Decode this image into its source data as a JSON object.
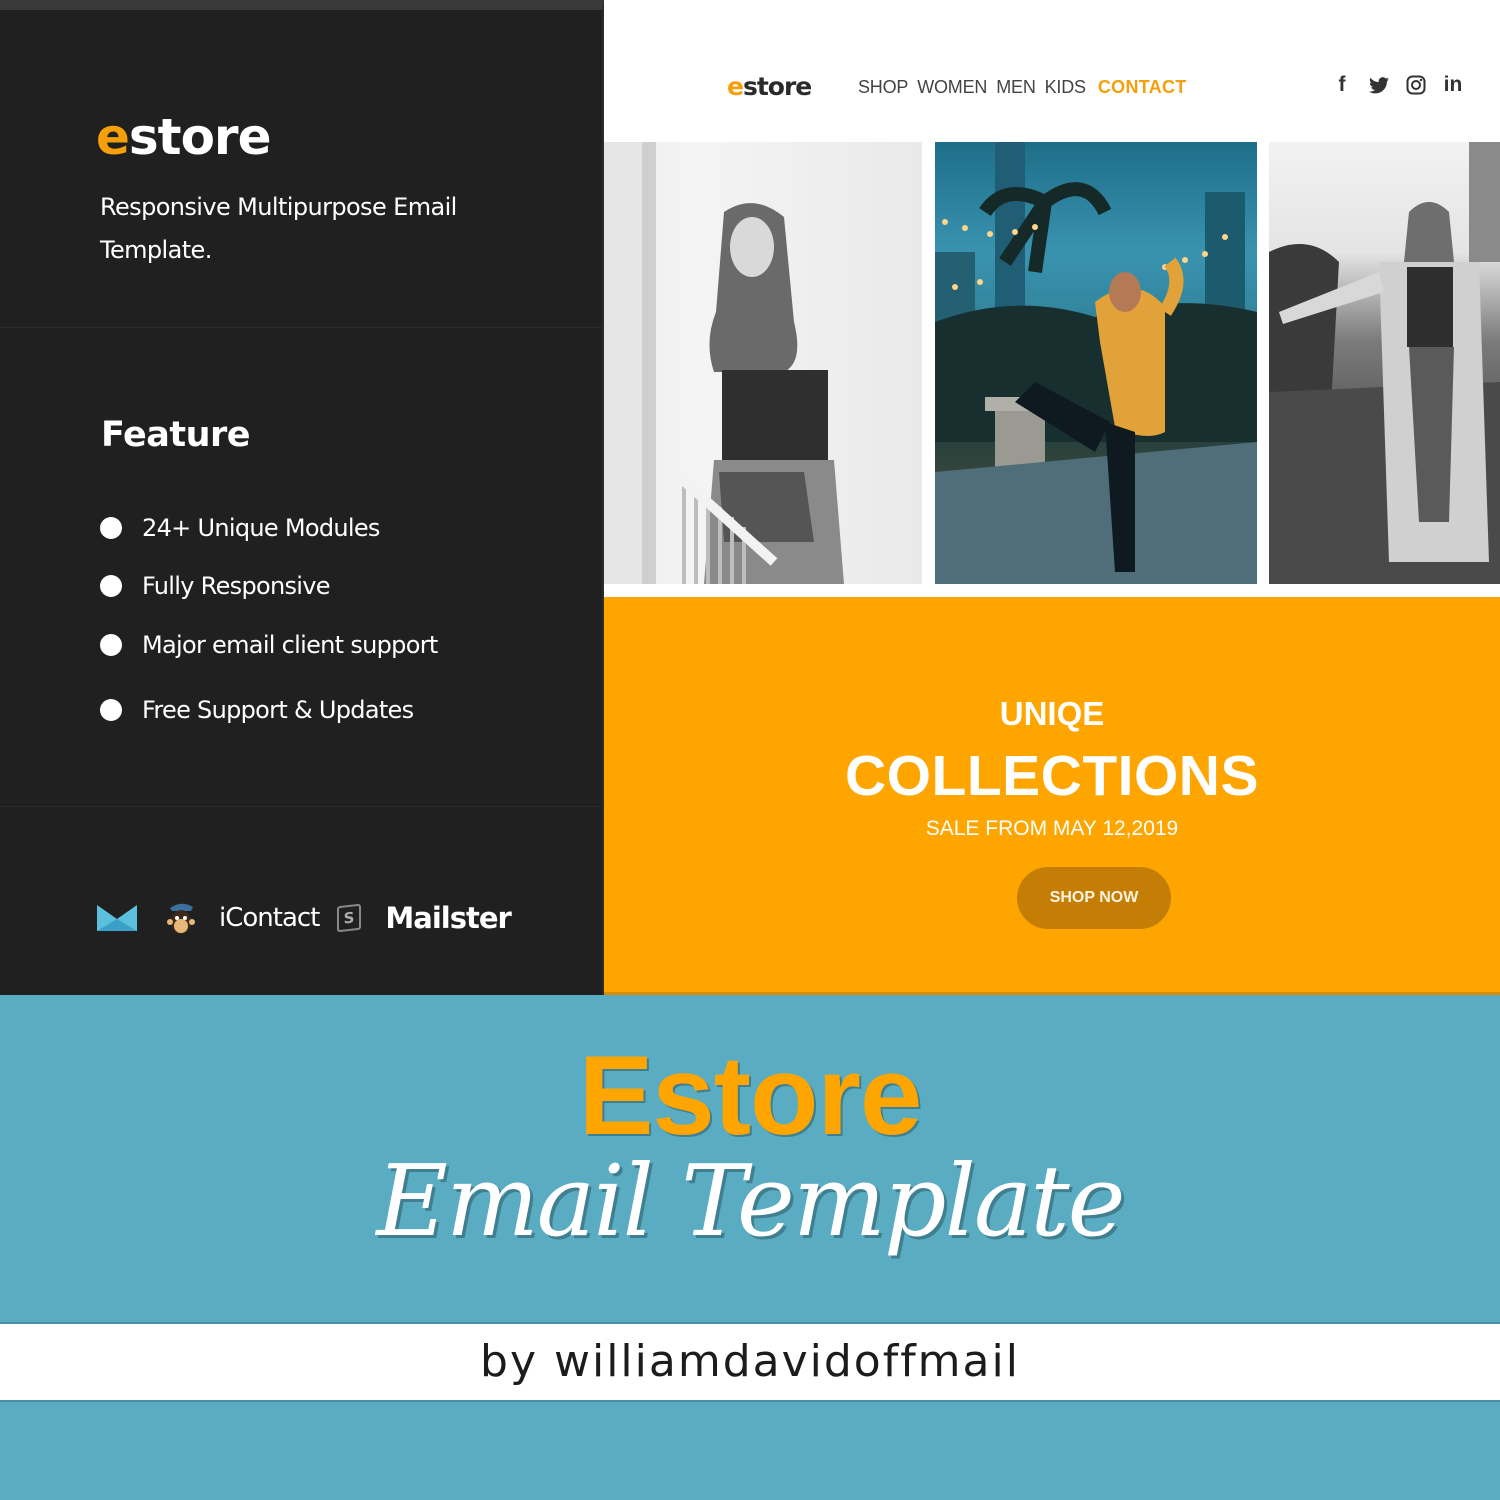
{
  "colors": {
    "accent_orange": "#fea500",
    "dark_panel": "#202020",
    "banner_teal": "#5aacc2",
    "button_brown": "#c47e06"
  },
  "left_panel": {
    "logo": {
      "accent_letter": "e",
      "rest": "store"
    },
    "tagline": "Responsive Multipurpose Email Template.",
    "feature_title": "Feature",
    "features": [
      "24+ Unique Modules",
      "Fully Responsive",
      "Major email client support",
      "Free Support & Updates"
    ],
    "clients": [
      {
        "name": "Campaign Monitor",
        "icon": "envelope-icon"
      },
      {
        "name": "Mailchimp",
        "icon": "mailchimp-monkey-icon"
      },
      {
        "name": "iContact",
        "label": "iContact"
      },
      {
        "name": "Stampready",
        "label": "S"
      },
      {
        "name": "Mailster",
        "label": "Mailster"
      }
    ]
  },
  "email_preview": {
    "logo": {
      "accent_letter": "e",
      "rest": "store"
    },
    "nav": [
      "SHOP",
      "WOMEN",
      "MEN",
      "KIDS",
      "CONTACT"
    ],
    "active_nav": "CONTACT",
    "social": [
      {
        "name": "facebook",
        "glyph": "f"
      },
      {
        "name": "twitter",
        "glyph": "twitter-bird"
      },
      {
        "name": "instagram",
        "glyph": "instagram"
      },
      {
        "name": "linkedin",
        "glyph": "in"
      }
    ],
    "photos": [
      {
        "alt": "Woman in black and white leaning on railing"
      },
      {
        "alt": "Woman in yellow sweater dancing in city at dusk"
      },
      {
        "alt": "Woman in cardigan walking, black and white"
      }
    ],
    "promo": {
      "subtitle": "UNIQE",
      "title": "COLLECTIONS",
      "date": "SALE FROM MAY 12,2019",
      "button": "SHOP NOW"
    }
  },
  "banner": {
    "title": "Estore",
    "subtitle": "Email Template",
    "author": "by williamdavidoffmail"
  }
}
